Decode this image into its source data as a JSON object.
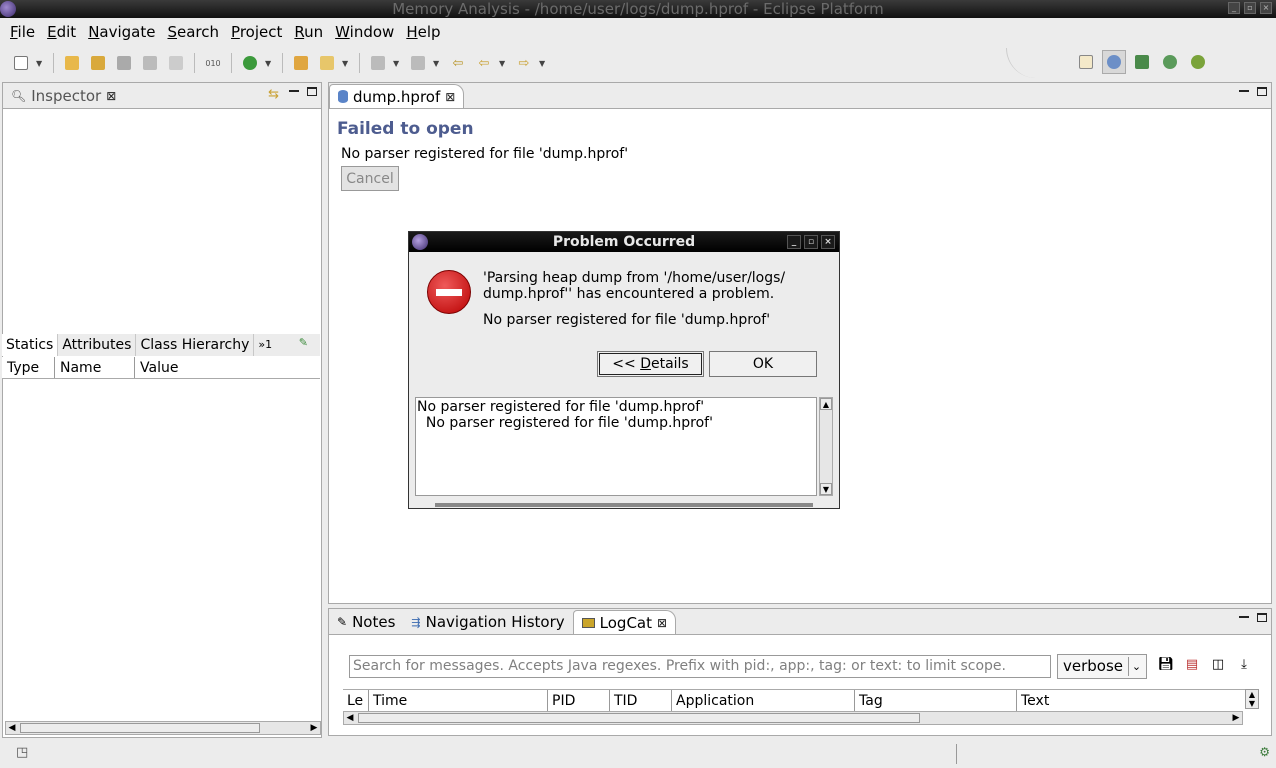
{
  "window": {
    "title": "Memory Analysis - /home/user/logs/dump.hprof - Eclipse Platform"
  },
  "menu": {
    "items": [
      {
        "label": "File",
        "mnemonic": "F",
        "rest": "ile"
      },
      {
        "label": "Edit",
        "mnemonic": "E",
        "rest": "dit"
      },
      {
        "label": "Navigate",
        "mnemonic": "N",
        "rest": "avigate"
      },
      {
        "label": "Search",
        "mnemonic": "S",
        "rest": "earch"
      },
      {
        "label": "Project",
        "mnemonic": "P",
        "rest": "roject"
      },
      {
        "label": "Run",
        "mnemonic": "R",
        "rest": "un"
      },
      {
        "label": "Window",
        "mnemonic": "W",
        "rest": "indow"
      },
      {
        "label": "Help",
        "mnemonic": "H",
        "rest": "elp"
      }
    ]
  },
  "inspector": {
    "tab_label": "Inspector",
    "subtabs": [
      "Statics",
      "Attributes",
      "Class Hierarchy",
      "»1"
    ],
    "columns": [
      "Type",
      "Name",
      "Value"
    ]
  },
  "editor": {
    "tab_label": "dump.hprof",
    "heading": "Failed to open",
    "message": "No parser registered for file 'dump.hprof'",
    "cancel_label": "Cancel"
  },
  "dialog": {
    "title": "Problem Occurred",
    "text_line1": "'Parsing heap dump from '/home/user/logs/",
    "text_line2": "dump.hprof'' has encountered a problem.",
    "reason": "No parser registered for file 'dump.hprof'",
    "details_prefix": "<< ",
    "details_mnemonic": "D",
    "details_rest": "etails",
    "ok_label": "OK",
    "details_lines": [
      "No parser registered for file 'dump.hprof'",
      "  No parser registered for file 'dump.hprof'"
    ]
  },
  "bottom": {
    "tabs": [
      "Notes",
      "Navigation History",
      "LogCat"
    ],
    "search_placeholder": "Search for messages. Accepts Java regexes. Prefix with pid:, app:, tag: or text: to limit scope.",
    "level": "verbose",
    "columns": [
      "Le",
      "Time",
      "PID",
      "TID",
      "Application",
      "Tag",
      "Text"
    ]
  }
}
